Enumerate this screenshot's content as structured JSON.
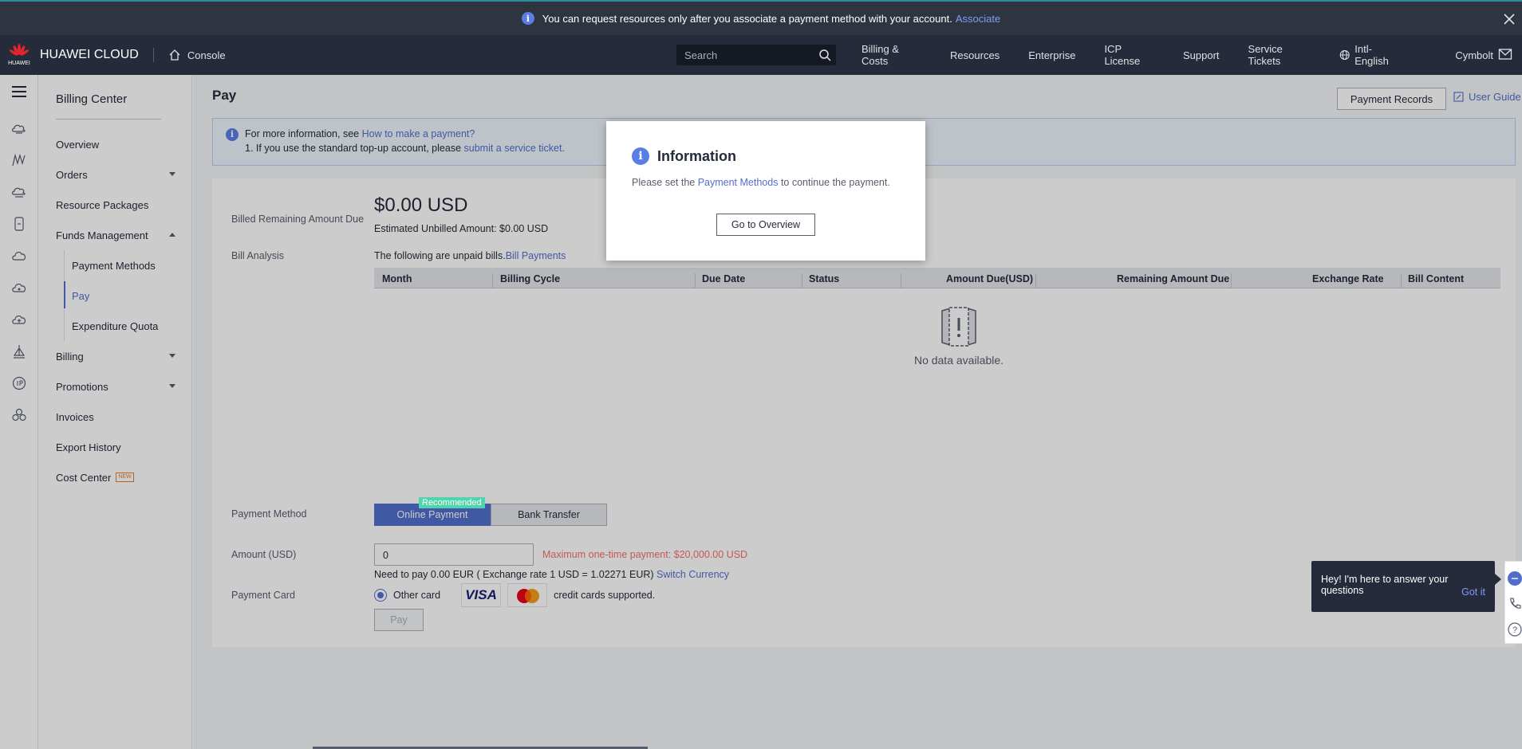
{
  "banner": {
    "text": "You can request resources only after you associate a payment method with your account.",
    "link": "Associate"
  },
  "topnav": {
    "logo_text": "HUAWEI",
    "brand": "HUAWEI CLOUD",
    "console": "Console",
    "search_placeholder": "Search",
    "items": [
      "Billing & Costs",
      "Resources",
      "Enterprise",
      "ICP License",
      "Support",
      "Service Tickets"
    ],
    "language": "Intl-English",
    "user": "Cymbolt"
  },
  "sidebar": {
    "title": "Billing Center",
    "items": {
      "overview": "Overview",
      "orders": "Orders",
      "resource_packages": "Resource Packages",
      "funds_management": "Funds Management",
      "payment_methods": "Payment Methods",
      "pay": "Pay",
      "expenditure_quota": "Expenditure Quota",
      "billing": "Billing",
      "promotions": "Promotions",
      "invoices": "Invoices",
      "export_history": "Export History",
      "cost_center": "Cost Center",
      "new_badge": "NEW"
    }
  },
  "page": {
    "title": "Pay",
    "payment_records": "Payment Records",
    "user_guide": "User Guide",
    "notice": {
      "line1_prefix": "For more information, see",
      "line1_link": "How to make a payment?",
      "line2_prefix": "1. If you use the standard top-up account, please",
      "line2_link": "submit a service ticket."
    },
    "billed_label": "Billed Remaining Amount Due",
    "amount": "$0.00 USD",
    "estimated": "Estimated Unbilled Amount: $0.00 USD",
    "bill_analysis_label": "Bill Analysis",
    "unpaid_text": "The following are unpaid bills.",
    "bill_payments_link": "Bill Payments",
    "table_headers": [
      "Month",
      "Billing Cycle",
      "Due Date",
      "Status",
      "Amount Due(USD)",
      "Remaining Amount Due",
      "Exchange Rate",
      "Bill Content"
    ],
    "no_data": "No data available.",
    "payment_method_label": "Payment Method",
    "recommended": "Recommended",
    "tab_online": "Online Payment",
    "tab_bank": "Bank Transfer",
    "amount_label": "Amount (USD)",
    "amount_value": "0",
    "max_payment": "Maximum one-time payment: $20,000.00 USD",
    "need_to_pay": "Need to pay 0.00 EUR ( Exchange rate 1 USD = 1.02271 EUR)",
    "switch_currency": "Switch Currency",
    "payment_card_label": "Payment Card",
    "other_card": "Other card",
    "visa": "VISA",
    "cards_supported": "credit cards supported.",
    "pay_button": "Pay"
  },
  "modal": {
    "title": "Information",
    "body_prefix": "Please set the",
    "body_link": "Payment Methods",
    "body_suffix": "to continue the payment.",
    "button": "Go to Overview"
  },
  "chat": {
    "text": "Hey! I'm here to answer your questions",
    "got_it": "Got it"
  },
  "colors": {
    "accent": "#526ecc",
    "topbar": "#252b3a",
    "warning": "#f66f6a"
  }
}
